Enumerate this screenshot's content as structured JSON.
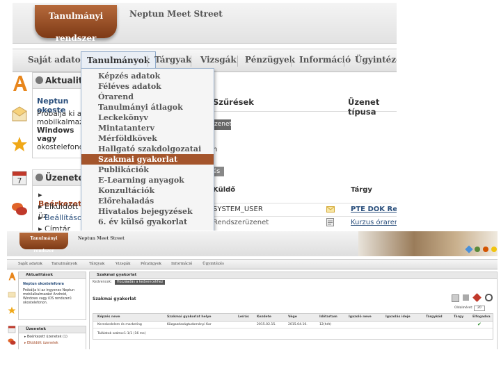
{
  "top": {
    "logo": "Tanulmányi rendszer",
    "meet_street": "Neptun Meet Street",
    "nav": [
      "Saját adatok",
      "Tanulmányok",
      "Tárgyak",
      "Vizsgák",
      "Pénzügyek",
      "Információ",
      "Ügyintézés"
    ],
    "nav_active_index": 1,
    "dropdown": [
      "Képzés adatok",
      "Féléves adatok",
      "Órarend",
      "Tanulmányi átlagok",
      "Leckekönyv",
      "Mintatanterv",
      "Mérföldkövek",
      "Hallgató szakdolgozatai",
      "Szakmai gyakorlat",
      "Publikációk",
      "E-Learning anyagok",
      "Konzultációk",
      "Előrehaladás",
      "Hivatalos bejegyzések",
      "6. év külső gyakorlat"
    ],
    "dropdown_highlight": "Szakmai gyakorlat",
    "aktualitasok": {
      "title": "Aktualitáso",
      "heading": "Neptun okoste",
      "lines": [
        "Próbálja ki az i",
        "mobilkalmaza",
        "Windows vagy",
        "okostelefonon."
      ]
    },
    "szuresek": "Szűrések",
    "uzenet_tipusa": "Üzenet típusa",
    "btn_fragment": "zenet",
    "letter_fragment": "n",
    "btn2_fragment": "és",
    "uzenetek": {
      "title": "Üzenetek",
      "items": [
        "Beérkezett",
        "Elküldött üz",
        "Beállítások",
        "Címtár"
      ]
    },
    "kuldo": "Küldő",
    "targy": "Tárgy",
    "row1": {
      "sender": "SYSTEM_USER",
      "subject": "PTE DOK Rend"
    },
    "row2": {
      "sender": "Rendszerüzenet",
      "subject": "Kurzus órarend"
    }
  },
  "bottom": {
    "logo": "Tanulmányi rendszer",
    "meet_street": "Neptun Meet Street",
    "nav": [
      "Saját adatok",
      "Tanulmányok",
      "Tárgyak",
      "Vizsgák",
      "Pénzügyek",
      "Információ",
      "Ügyintézés"
    ],
    "aktualitasok_title": "Aktualitások",
    "neptun_okostelefonra": "Neptun okostelefonra",
    "promo_lines": [
      "Próbálja ki az ingyenes Neptun",
      "mobilalkalmazást Android,",
      "Windows vagy iOS rendszerű",
      "okostelefonon."
    ],
    "uzenetek_title": "Üzenetek",
    "uzenetek_items": [
      "Beérkezett üzenetek (1)",
      "Elküldött üzenetek"
    ],
    "main_title": "Szakmai gyakorlat",
    "kedvencek_label": "Kedvencek:",
    "kedvencek_button": "Hozzáadás a kedvencekhez",
    "section_title": "Szakmai gyakorlat",
    "columns": [
      "Képzés neve",
      "Szakmai gyakorlat helye",
      "Leírás",
      "Kezdete",
      "Vége",
      "Időtartam",
      "Igazoló neve",
      "Igazolás ideje",
      "Tárgykód",
      "Tárgy",
      "Elfogadva"
    ],
    "rows": [
      [
        "Kereskedelem és marketing",
        "Közgazdaságtudományi Kar",
        "",
        "2015.02.15.",
        "2015.04.10.",
        "12(hét)",
        "",
        "",
        "",
        "",
        "✔"
      ]
    ],
    "oldal_label": "Oldalméret:",
    "oldal_value": "20",
    "footer": "Találatok száma:1-1/1 (16 ms)"
  }
}
